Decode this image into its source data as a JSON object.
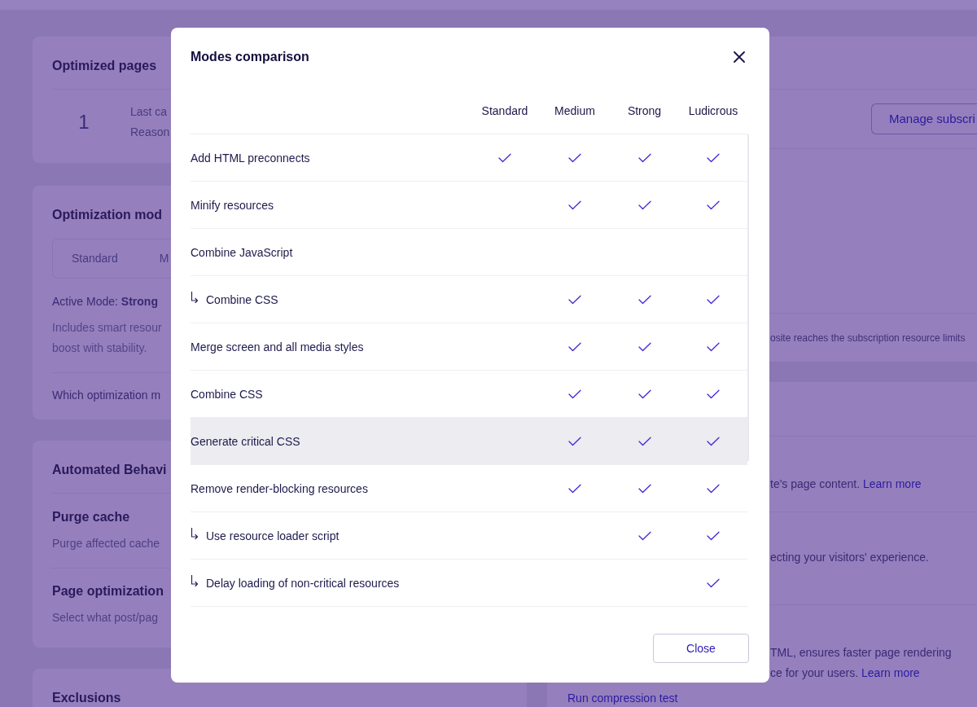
{
  "optimized_pages": {
    "title": "Optimized pages",
    "count": "1",
    "lines": [
      "Last ca",
      "Reason"
    ]
  },
  "optimization_mode": {
    "title": "Optimization mod",
    "tabs": [
      {
        "label": "Standard",
        "selected": false
      },
      {
        "label": "M",
        "selected": false
      }
    ],
    "active_mode": "Active Mode: **Strong**",
    "description": [
      "Includes smart resour",
      "boost with stability."
    ],
    "question": "Which optimization m"
  },
  "automated_behavior": {
    "title": "Automated Behavi",
    "settings": [
      {
        "title": "Purge cache",
        "description": "Purge affected cache"
      },
      {
        "title": "Page optimization",
        "description": "Select what post/pag"
      }
    ]
  },
  "exclusions": {
    "title": "Exclusions"
  },
  "subscription": {
    "button": "Manage subscri",
    "note": "osite reaches the subscription resource limits"
  },
  "settings_panel": {
    "items": [
      {
        "lines": [
          "te's page content."
        ],
        "link": "Learn more"
      },
      {
        "lines": [
          "ecting your visitors' experience."
        ]
      },
      {
        "lines": [
          "TML, ensures faster page rendering",
          "ce for your users."
        ],
        "link": "Learn more"
      }
    ],
    "action_link": "Run compression test"
  },
  "modal": {
    "title": "Modes comparison",
    "columns": [
      "Standard",
      "Medium",
      "Strong",
      "Ludicrous"
    ],
    "rows": [
      {
        "label": "Add HTML preconnects",
        "modes": [
          true,
          true,
          true,
          true
        ],
        "highlighted": false
      },
      {
        "label": "Minify resources",
        "modes": [
          false,
          true,
          true,
          true
        ],
        "highlighted": false
      },
      {
        "label": "Combine JavaScript",
        "modes": [
          false,
          false,
          false,
          false
        ],
        "highlighted": false,
        "children": [
          {
            "label": "Combine CSS",
            "modes": [
              false,
              true,
              true,
              true
            ],
            "highlighted": false
          }
        ]
      },
      {
        "label": "Merge screen and all media styles",
        "modes": [
          false,
          true,
          true,
          true
        ],
        "highlighted": false
      },
      {
        "label": "Combine CSS",
        "modes": [
          false,
          true,
          true,
          true
        ],
        "highlighted": false
      },
      {
        "label": "Generate critical CSS",
        "modes": [
          false,
          true,
          true,
          true
        ],
        "highlighted": true
      },
      {
        "label": "Remove render-blocking resources",
        "modes": [
          false,
          true,
          true,
          true
        ],
        "highlighted": false,
        "children": [
          {
            "label": "Use resource loader script",
            "modes": [
              false,
              false,
              true,
              true
            ],
            "highlighted": false
          },
          {
            "label": "Delay loading of non-critical resources",
            "modes": [
              false,
              false,
              false,
              true
            ],
            "highlighted": false
          }
        ]
      }
    ],
    "close_button": "Close"
  }
}
